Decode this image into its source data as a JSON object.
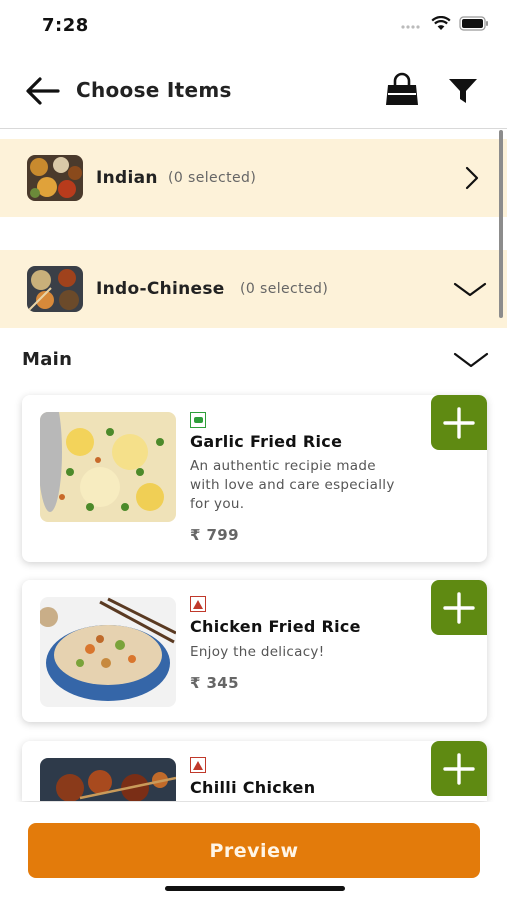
{
  "status": {
    "time": "7:28"
  },
  "header": {
    "title": "Choose Items"
  },
  "categories": [
    {
      "name": "Indian",
      "count": "(0 selected)"
    },
    {
      "name": "Indo-Chinese",
      "count": "(0 selected)"
    }
  ],
  "section": {
    "title": "Main"
  },
  "items": [
    {
      "name": "Garlic Fried Rice",
      "description": "An authentic recipie made with love and care especially for you.",
      "price": "₹ 799",
      "diet": "veg"
    },
    {
      "name": "Chicken Fried Rice",
      "description": "Enjoy the delicacy!",
      "price": "₹ 345",
      "diet": "non-veg"
    },
    {
      "name": "Chilli Chicken",
      "description": "",
      "price": "",
      "diet": "non-veg"
    }
  ],
  "footer": {
    "preview_label": "Preview"
  },
  "colors": {
    "accent_orange": "#e37b0b",
    "add_green": "#5f8a12",
    "category_bg": "#fdf2d9",
    "veg": "#2e9e3a",
    "non_veg": "#c0392b"
  },
  "icons": [
    "back-arrow-icon",
    "shopping-bag-icon",
    "filter-icon",
    "chevron-right-icon",
    "chevron-down-icon",
    "plus-icon",
    "veg-icon",
    "non-veg-icon"
  ]
}
